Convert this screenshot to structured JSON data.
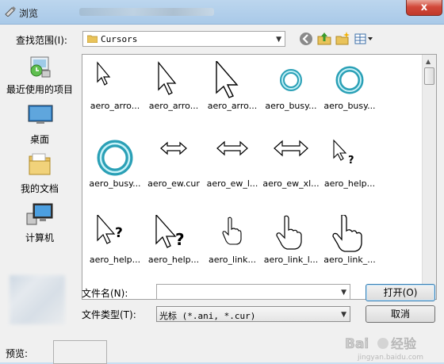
{
  "window": {
    "title": "浏览",
    "close_glyph": "x"
  },
  "toolbar": {
    "look_in_label": "查找范围(I):",
    "look_in_value": "Cursors",
    "icons": [
      "back-icon",
      "up-folder-icon",
      "new-folder-icon",
      "view-menu-icon"
    ]
  },
  "places": [
    {
      "label": "最近使用的项目",
      "icon": "recent-places-icon"
    },
    {
      "label": "桌面",
      "icon": "desktop-icon"
    },
    {
      "label": "我的文档",
      "icon": "documents-icon"
    },
    {
      "label": "计算机",
      "icon": "computer-icon"
    }
  ],
  "files": [
    {
      "name": "aero_arro...",
      "icon": "arrow-small"
    },
    {
      "name": "aero_arro...",
      "icon": "arrow-medium"
    },
    {
      "name": "aero_arro...",
      "icon": "arrow-large"
    },
    {
      "name": "aero_busy...",
      "icon": "busy-small"
    },
    {
      "name": "aero_busy...",
      "icon": "busy-medium"
    },
    {
      "name": "aero_busy...",
      "icon": "busy-large"
    },
    {
      "name": "aero_ew.cur",
      "icon": "ew-small"
    },
    {
      "name": "aero_ew_l...",
      "icon": "ew-medium"
    },
    {
      "name": "aero_ew_xl...",
      "icon": "ew-large"
    },
    {
      "name": "aero_help...",
      "icon": "help-small"
    },
    {
      "name": "aero_help...",
      "icon": "help-medium"
    },
    {
      "name": "aero_help...",
      "icon": "help-large"
    },
    {
      "name": "aero_link...",
      "icon": "link-small"
    },
    {
      "name": "aero_link_l...",
      "icon": "link-medium"
    },
    {
      "name": "aero_link_...",
      "icon": "link-large"
    }
  ],
  "form": {
    "filename_label": "文件名(N):",
    "filename_value": "",
    "filetype_label": "文件类型(T):",
    "filetype_value": "光标 (*.ani, *.cur)"
  },
  "buttons": {
    "open": "打开(O)",
    "cancel": "取消"
  },
  "preview": {
    "label": "预览:"
  },
  "watermark": {
    "text": "Bai经验",
    "sub": "jingyan.baidu.com"
  },
  "colors": {
    "titlebar": "#bcd6ee",
    "close": "#c0392b",
    "busy_ring": "#3aa3b8"
  }
}
